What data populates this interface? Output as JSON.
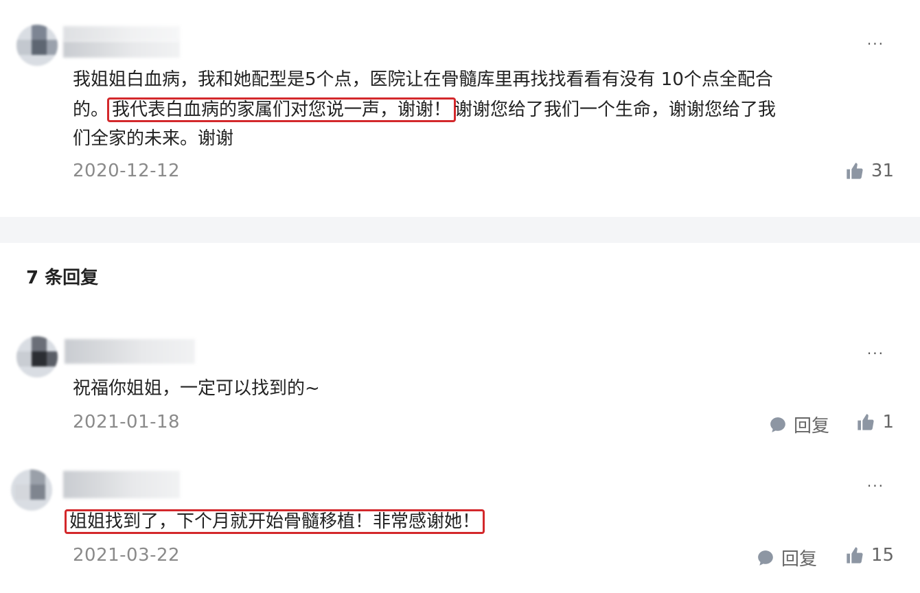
{
  "post": {
    "line1": "我姐姐白血病，我和她配型是5个点，医院让在骨髓库里再找找看看有没有 10个点全配合",
    "line2_pre": "的。",
    "line2_highlight": "我代表白血病的家属们对您说一声，谢谢！",
    "line2_post": "谢谢您给了我们一个生命，谢谢您给了我",
    "line3": "们全家的未来。谢谢",
    "date": "2020-12-12",
    "like_count": "31",
    "more_label": "···"
  },
  "replies_header": "7 条回复",
  "replies": [
    {
      "text": "祝福你姐姐，一定可以找到的~",
      "date": "2021-01-18",
      "reply_label": "回复",
      "like_count": "1",
      "more_label": "···"
    },
    {
      "text": "姐姐找到了，下个月就开始骨髓移植！非常感谢她！",
      "date": "2021-03-22",
      "reply_label": "回复",
      "like_count": "15",
      "more_label": "···"
    }
  ],
  "colors": {
    "highlight_border": "#d3282b",
    "icon_gray": "#8d96a3",
    "date_gray": "#8a8a8a"
  }
}
